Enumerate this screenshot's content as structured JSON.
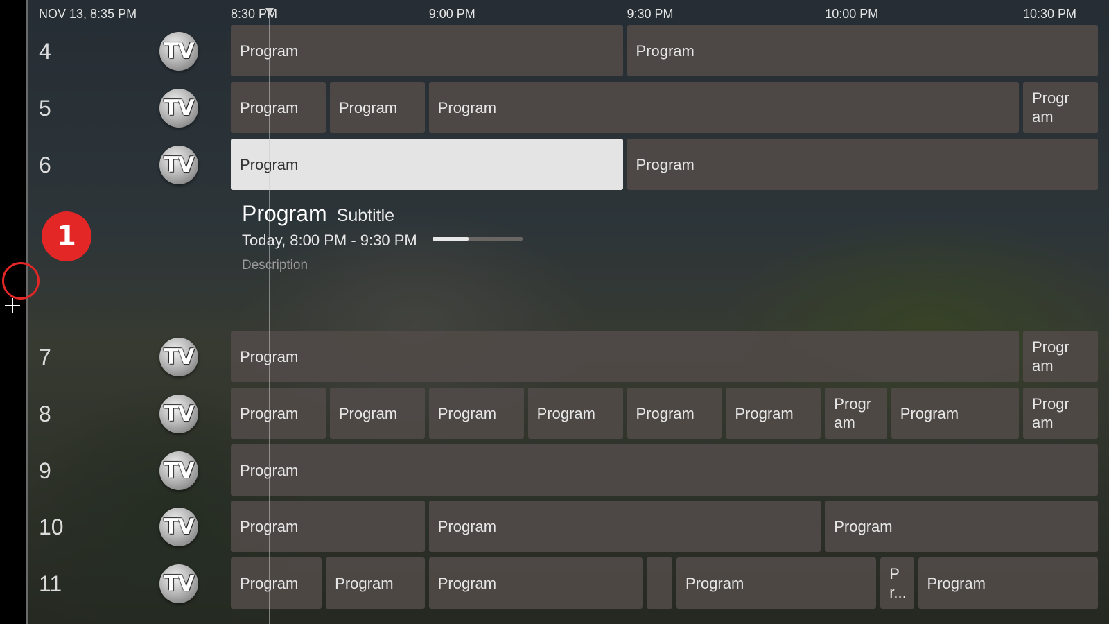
{
  "header": {
    "datetime": "NOV 13, 8:35 PM"
  },
  "timeline": {
    "labels": [
      "8:30 PM",
      "9:00 PM",
      "9:30 PM",
      "10:00 PM",
      "10:30 PM"
    ]
  },
  "channels": [
    {
      "number": "4",
      "logo": "TV",
      "programs": [
        {
          "title": "Program",
          "start": 0,
          "end": 1
        },
        {
          "title": "Program",
          "start": 1,
          "end": 2.2
        }
      ]
    },
    {
      "number": "5",
      "logo": "TV",
      "programs": [
        {
          "title": "Program",
          "start": 0,
          "end": 0.25
        },
        {
          "title": "Program",
          "start": 0.25,
          "end": 0.5
        },
        {
          "title": "Program",
          "start": 0.5,
          "end": 2.0
        },
        {
          "title": "Progr am",
          "start": 2.0,
          "end": 2.2
        }
      ]
    },
    {
      "number": "6",
      "logo": "TV",
      "programs": [
        {
          "title": "Program",
          "start": 0,
          "end": 1,
          "focused": true
        },
        {
          "title": "Program",
          "start": 1,
          "end": 2.2
        }
      ]
    },
    {
      "number": "7",
      "logo": "TV",
      "programs": [
        {
          "title": "Program",
          "start": 0,
          "end": 2.0
        },
        {
          "title": "Progr am",
          "start": 2.0,
          "end": 2.2
        }
      ]
    },
    {
      "number": "8",
      "logo": "TV",
      "programs": [
        {
          "title": "Program",
          "start": 0,
          "end": 0.25
        },
        {
          "title": "Program",
          "start": 0.25,
          "end": 0.5
        },
        {
          "title": "Program",
          "start": 0.5,
          "end": 0.75
        },
        {
          "title": "Program",
          "start": 0.75,
          "end": 1.0
        },
        {
          "title": "Program",
          "start": 1.0,
          "end": 1.25
        },
        {
          "title": "Program",
          "start": 1.25,
          "end": 1.5
        },
        {
          "title": "Progr am",
          "start": 1.5,
          "end": 1.667
        },
        {
          "title": "Program",
          "start": 1.667,
          "end": 2.0
        },
        {
          "title": "Progr am",
          "start": 2.0,
          "end": 2.2
        }
      ]
    },
    {
      "number": "9",
      "logo": "TV",
      "programs": [
        {
          "title": "Program",
          "start": 0,
          "end": 2.2
        }
      ]
    },
    {
      "number": "10",
      "logo": "TV",
      "programs": [
        {
          "title": "Program",
          "start": 0,
          "end": 0.5
        },
        {
          "title": "Program",
          "start": 0.5,
          "end": 1.5
        },
        {
          "title": "Program",
          "start": 1.5,
          "end": 2.2
        }
      ]
    },
    {
      "number": "11",
      "logo": "TV",
      "programs": [
        {
          "title": "Program",
          "start": 0,
          "end": 0.24
        },
        {
          "title": "Program",
          "start": 0.24,
          "end": 0.5
        },
        {
          "title": "Program",
          "start": 0.5,
          "end": 1.05
        },
        {
          "title": "",
          "start": 1.05,
          "end": 1.125
        },
        {
          "title": "Program",
          "start": 1.125,
          "end": 1.64
        },
        {
          "title": "P r...",
          "start": 1.64,
          "end": 1.735
        },
        {
          "title": "Program",
          "start": 1.735,
          "end": 2.2
        }
      ]
    }
  ],
  "details": {
    "title": "Program",
    "subtitle": "Subtitle",
    "time": "Today, 8:00 PM - 9:30 PM",
    "progress": 0.4,
    "description": "Description"
  },
  "overlay": {
    "badge": "1"
  },
  "colors": {
    "focused": "#e4e4e4",
    "program": "#504a48",
    "badge": "#e32626"
  }
}
